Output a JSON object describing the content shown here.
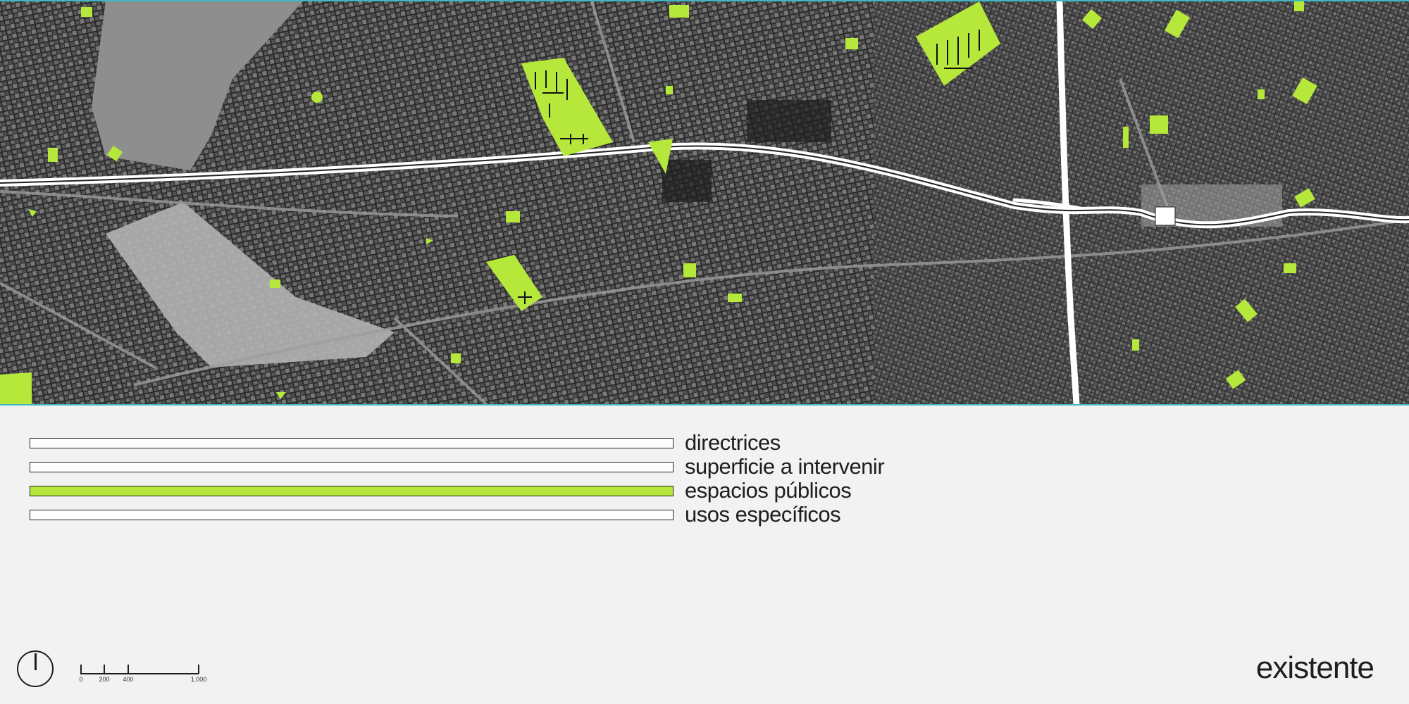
{
  "map": {
    "colors": {
      "urban": "#3a3a3a",
      "rail_yard": "#a8a8a8",
      "road": "#ffffff",
      "public_space": "#b5e83a",
      "frame": "#3fb8c4"
    }
  },
  "legend": {
    "items": [
      {
        "label": "directrices",
        "fill": "#ffffff"
      },
      {
        "label": "superficie a intervenir",
        "fill": "#ffffff"
      },
      {
        "label": "espacios públicos",
        "fill": "#b5e83a"
      },
      {
        "label": "usos específicos",
        "fill": "#ffffff"
      }
    ]
  },
  "scale": {
    "labels": [
      "0",
      "200",
      "400",
      "1.000"
    ]
  },
  "north_arrow": {
    "icon": "north-arrow-icon"
  },
  "title": "existente"
}
